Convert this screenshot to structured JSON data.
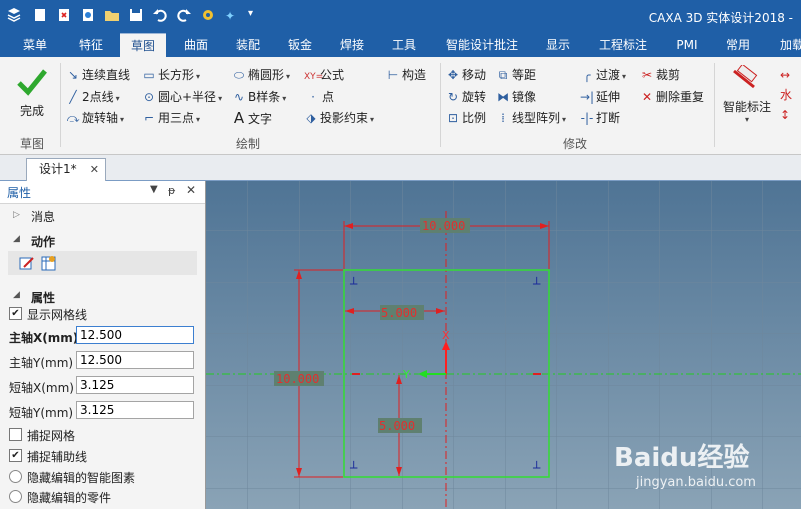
{
  "app": {
    "title": "CAXA 3D 实体设计2018 -"
  },
  "menu": [
    "菜单",
    "特征",
    "草图",
    "曲面",
    "装配",
    "钣金",
    "焊接",
    "工具",
    "智能设计批注",
    "显示",
    "工程标注",
    "PMI",
    "常用",
    "加载"
  ],
  "ribbon": {
    "finish": "完成",
    "finish_group": "草图",
    "draw": {
      "polyline": "连续直线",
      "rectangle": "长方形",
      "ellipse": "椭圆形",
      "formula": "公式",
      "construct": "构造",
      "two_point_line": "2点线",
      "circle_center_radius": "圆心+半径",
      "bspline": "B样条",
      "point": "点",
      "rotate_axis": "旋转轴",
      "three_point": "用三点",
      "text": "文字",
      "projection": "投影约束",
      "group_label": "绘制"
    },
    "modify": {
      "move": "移动",
      "offset": "等距",
      "fillet": "过渡",
      "trim": "裁剪",
      "rotate": "旋转",
      "mirror": "镜像",
      "extend": "延伸",
      "delete_dup": "删除重复",
      "scale": "比例",
      "linear_array": "线型阵列",
      "break": "打断",
      "group_label": "修改"
    },
    "smart_dim": "智能标注"
  },
  "doc_tab": "设计1*",
  "panel": {
    "title": "属性",
    "messages": "消息",
    "actions": "动作",
    "properties": "属性",
    "show_grid": {
      "label": "显示网格线",
      "checked": true
    },
    "fields": [
      {
        "label": "主轴X(mm)",
        "value": "12.500"
      },
      {
        "label": "主轴Y(mm)",
        "value": "12.500"
      },
      {
        "label": "短轴X(mm)",
        "value": "3.125"
      },
      {
        "label": "短轴Y(mm)",
        "value": "3.125"
      }
    ],
    "snap_grid": {
      "label": "捕捉网格",
      "checked": false
    },
    "snap_aux": {
      "label": "捕捉辅助线",
      "checked": true
    },
    "hide_smart": "隐藏编辑的智能图素",
    "hide_part": "隐藏编辑的零件"
  },
  "sketch": {
    "dim_top": "10.000",
    "dim_left": "10.000",
    "dim_half_x": "5.000",
    "dim_half_y": "5.000",
    "axis_x": "X",
    "axis_y": "Y"
  },
  "watermark": {
    "brand": "Baidu经验",
    "url": "jingyan.baidu.com"
  },
  "colors": {
    "accent": "#1f5fa7",
    "sketch": "#33dd33",
    "dim": "#e02020",
    "axis": "#ff2020"
  }
}
